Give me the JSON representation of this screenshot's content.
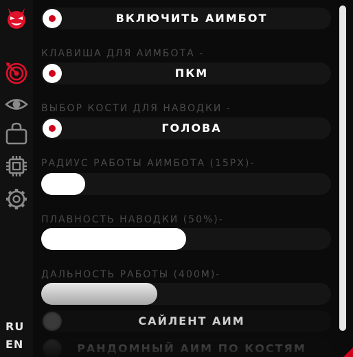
{
  "sidebar": {
    "icons": [
      {
        "name": "devil-face-icon",
        "active": true
      },
      {
        "name": "target-icon",
        "active": true
      },
      {
        "name": "eye-icon",
        "active": false
      },
      {
        "name": "bag-icon",
        "active": false
      },
      {
        "name": "chip-icon",
        "active": false
      },
      {
        "name": "gear-icon",
        "active": false
      }
    ],
    "lang_ru": "RU",
    "lang_en": "EN"
  },
  "settings": {
    "aimbot_toggle": {
      "label": "ВКЛЮЧИТЬ АИМБОТ",
      "enabled": true
    },
    "aimbot_key": {
      "section_label": "КЛАВИША ДЛЯ АИМБОТА -",
      "value": "ПКМ"
    },
    "bone_select": {
      "section_label": "ВЫБОР КОСТИ ДЛЯ НАВОДКИ -",
      "value": "ГОЛОВА"
    },
    "radius": {
      "section_label": "РАДИУС РАБОТЫ АИМБОТА (15PX)-",
      "level": 0.15
    },
    "smoothness": {
      "section_label": "ПЛАВНОСТЬ НАВОДКИ (50%)-",
      "level": 0.5
    },
    "distance": {
      "section_label": "ДАЛЬНОСТЬ РАБОТЫ (400М)-",
      "level": 0.4
    },
    "silent_aim": {
      "label": "САЙЛЕНТ АИМ",
      "enabled": false
    },
    "random_bones": {
      "label": "РАНДОМНЫЙ АИМ ПО КОСТЯМ",
      "enabled": false
    }
  },
  "colors": {
    "accent": "#d0011b",
    "background": "#0b0b0b",
    "row": "#151515",
    "section_text": "#4a4a4a"
  }
}
